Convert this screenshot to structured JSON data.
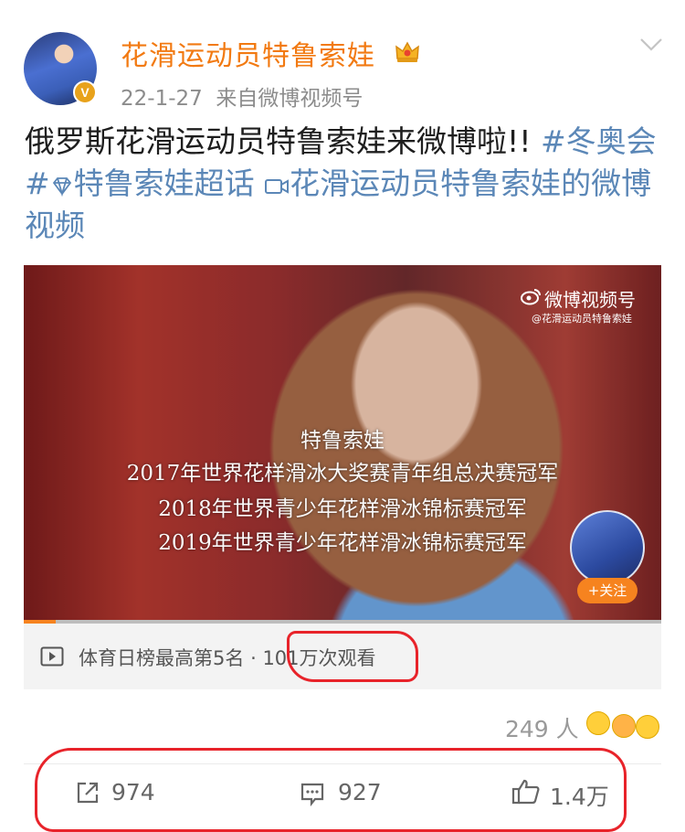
{
  "author": {
    "name": "花滑运动员特鲁索娃",
    "avatar_icon": "skater-avatar",
    "verified_badge": "V",
    "date": "22-1-27",
    "source": "来自微博视频号"
  },
  "post": {
    "text": "俄罗斯花滑运动员特鲁索娃来微博啦!! ",
    "hashtag": "#冬奥会#",
    "supertopic": "特鲁索娃超话",
    "video_link": "花滑运动员特鲁索娃的微博视频"
  },
  "video": {
    "watermark": "微博视频号",
    "watermark_handle": "@花滑运动员特鲁索娃",
    "captions": [
      "特鲁索娃",
      "2017年世界花样滑冰大奖赛青年组总决赛冠军",
      "2018年世界青少年花样滑冰锦标赛冠军",
      "2019年世界青少年花样滑冰锦标赛冠军"
    ],
    "follow_label": "+关注",
    "progress": 0.05
  },
  "stats": {
    "ranking": "体育日榜最高第5名",
    "separator": "·",
    "views": "101万次观看"
  },
  "reactions": {
    "count_label": "249 人"
  },
  "actions": {
    "repost_count": "974",
    "comment_count": "927",
    "like_count": "1.4万"
  },
  "colors": {
    "username": "#f27a12",
    "link": "#5b87b7",
    "annotation": "#e8232a",
    "follow": "#f6831f"
  }
}
